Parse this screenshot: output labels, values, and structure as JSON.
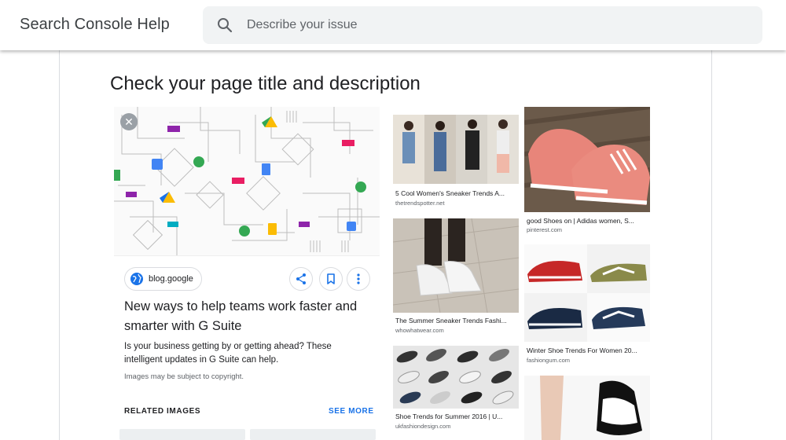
{
  "header": {
    "app_title": "Search Console Help",
    "search_placeholder": "Describe your issue"
  },
  "page": {
    "title": "Check your page title and description"
  },
  "card": {
    "site_chip": "blog.google",
    "headline": "New ways to help teams work faster and smarter with G Suite",
    "description": "Is your business getting by or getting ahead? These intelligent updates in G Suite can help.",
    "copyright_note": "Images may be subject to copyright.",
    "related_label": "RELATED IMAGES",
    "see_more_label": "SEE MORE"
  },
  "results": [
    {
      "caption": "5 Cool Women's Sneaker Trends A...",
      "source": "thetrendspotter.net"
    },
    {
      "caption": "good Shoes on | Adidas women, S...",
      "source": "pinterest.com"
    },
    {
      "caption": "The Summer Sneaker Trends Fashi...",
      "source": "whowhatwear.com"
    },
    {
      "caption": "Winter Shoe Trends For Women 20...",
      "source": "fashiongum.com"
    },
    {
      "caption": "Shoe Trends for Summer 2016 | U...",
      "source": "ukfashiondesign.com"
    }
  ],
  "colors": {
    "accent": "#1a73e8",
    "search_bg": "#f1f3f4",
    "text": "#202124",
    "secondary_text": "#5f6368"
  },
  "icons": {
    "search": "search-icon",
    "close": "close-icon",
    "globe": "globe-icon",
    "share": "share-icon",
    "bookmark": "bookmark-icon",
    "more": "more-vert-icon"
  }
}
